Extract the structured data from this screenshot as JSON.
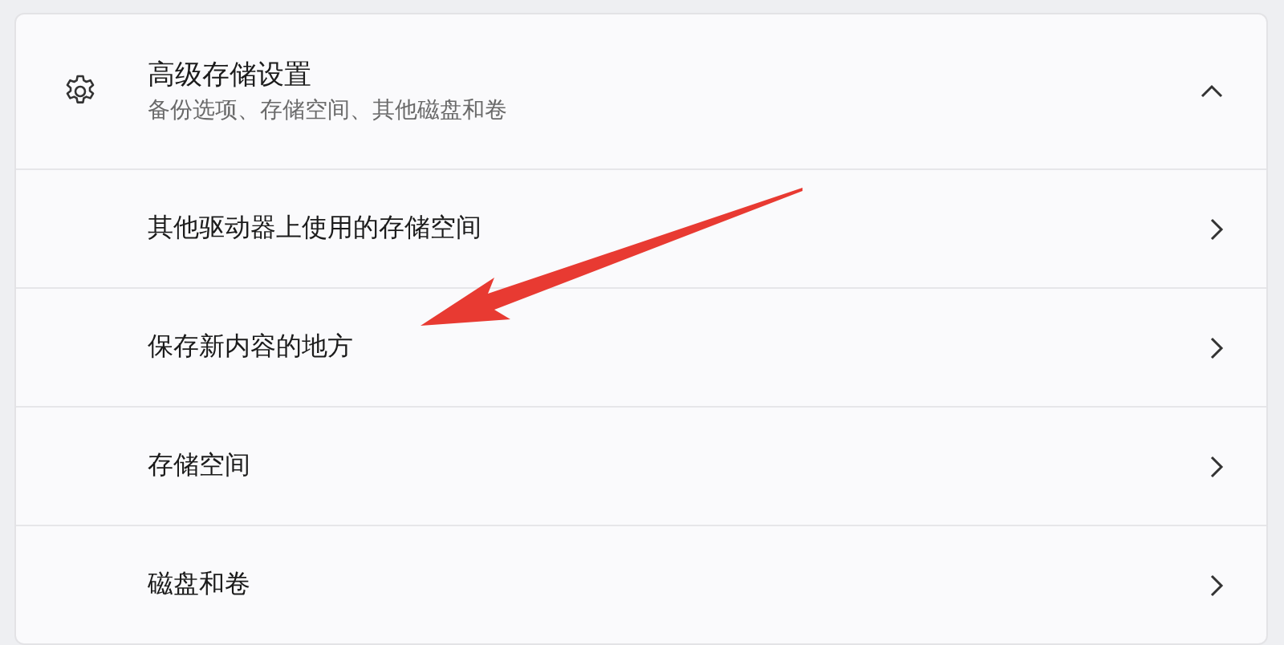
{
  "section": {
    "title": "高级存储设置",
    "subtitle": "备份选项、存储空间、其他磁盘和卷",
    "expanded": true
  },
  "items": [
    {
      "label": "其他驱动器上使用的存储空间"
    },
    {
      "label": "保存新内容的地方"
    },
    {
      "label": "存储空间"
    },
    {
      "label": "磁盘和卷"
    }
  ]
}
